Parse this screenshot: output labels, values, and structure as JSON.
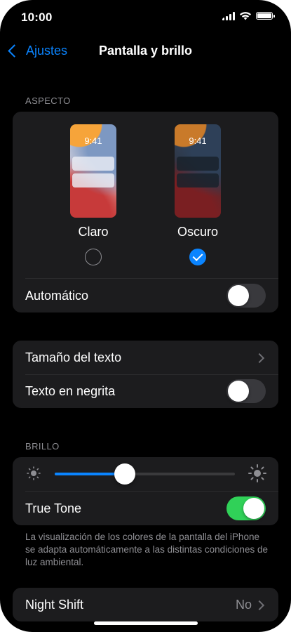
{
  "status_bar": {
    "time": "10:00"
  },
  "nav": {
    "back_label": "Ajustes",
    "title": "Pantalla y brillo"
  },
  "appearance": {
    "header": "ASPECTO",
    "light": {
      "preview_time": "9:41",
      "label": "Claro",
      "selected": false
    },
    "dark": {
      "preview_time": "9:41",
      "label": "Oscuro",
      "selected": true
    },
    "automatic": {
      "label": "Automático",
      "enabled": false
    }
  },
  "text": {
    "size_label": "Tamaño del texto",
    "bold": {
      "label": "Texto en negrita",
      "enabled": false
    }
  },
  "brightness": {
    "header": "BRILLO",
    "level": 0.39,
    "true_tone": {
      "label": "True Tone",
      "enabled": true
    },
    "footer": "La visualización de los colores de la pantalla del iPhone se adapta automáticamente a las distintas condiciones de luz ambiental."
  },
  "night_shift": {
    "label": "Night Shift",
    "value": "No"
  },
  "colors": {
    "accent": "#0a84ff",
    "switch_on": "#30d158",
    "background": "#000000",
    "card": "#1c1c1e"
  }
}
